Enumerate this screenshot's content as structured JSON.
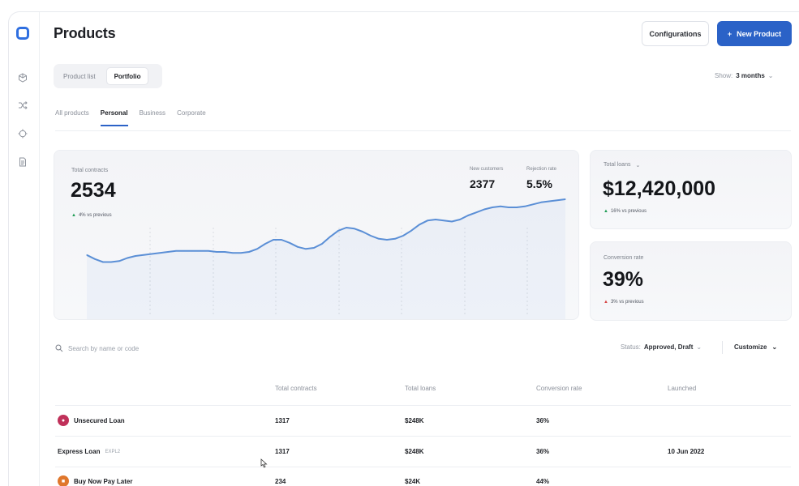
{
  "header": {
    "title": "Products",
    "configurations_label": "Configurations",
    "new_product_label": "New Product",
    "new_product_icon": "plus-icon"
  },
  "view_switch": {
    "options": [
      "Product list",
      "Portfolio"
    ],
    "selected": "Portfolio"
  },
  "range": {
    "prefix": "Show:",
    "value": "3 months"
  },
  "tabs": [
    {
      "label": "All products",
      "active": false
    },
    {
      "label": "Personal",
      "active": true
    },
    {
      "label": "Business",
      "active": false
    },
    {
      "label": "Corporate",
      "active": false
    }
  ],
  "contracts_card": {
    "label": "Total contracts",
    "value": "2534",
    "delta": "4% vs previous",
    "delta_direction": "up",
    "new_customers_label": "New customers",
    "new_customers_value": "2377",
    "rejection_label": "Rejection rate",
    "rejection_value": "5.5%"
  },
  "loans_card": {
    "label": "Total loans",
    "value": "$12,420,000",
    "delta": "16% vs previous",
    "delta_direction": "up"
  },
  "conversion_card": {
    "label": "Conversion rate",
    "value": "39%",
    "delta": "3% vs previous",
    "delta_direction": "down"
  },
  "chart_data": {
    "type": "line",
    "x": [
      0,
      1,
      2,
      3,
      4,
      5,
      6,
      7,
      8,
      9,
      10,
      11,
      12,
      13,
      14,
      15,
      16,
      17,
      18,
      19,
      20,
      21,
      22,
      23,
      24,
      25,
      26,
      27,
      28,
      29,
      30,
      31,
      32,
      33,
      34,
      35,
      36,
      37,
      38,
      39,
      40,
      41,
      42,
      43,
      44,
      45,
      46,
      47,
      48,
      49,
      50,
      51,
      52,
      53,
      54,
      55,
      56,
      57,
      58,
      59
    ],
    "y": [
      37,
      33,
      30,
      30,
      31,
      34,
      36,
      37,
      38,
      39,
      40,
      41,
      41,
      41,
      41,
      41,
      40,
      40,
      39,
      39,
      40,
      43,
      48,
      52,
      52,
      49,
      45,
      43,
      44,
      48,
      55,
      61,
      64,
      63,
      60,
      56,
      53,
      52,
      53,
      56,
      61,
      67,
      71,
      72,
      71,
      70,
      72,
      76,
      79,
      82,
      84,
      85,
      84,
      84,
      85,
      87,
      89,
      90,
      91,
      92
    ],
    "line_color": "#5b8fd6"
  },
  "table": {
    "search_placeholder": "Search by name or code",
    "status_prefix": "Status:",
    "status_value": "Approved, Draft",
    "customize_label": "Customize",
    "columns": [
      "Total contracts",
      "Total loans",
      "Conversion rate",
      "Launched"
    ],
    "rows": [
      {
        "name": "Unsecured Loan",
        "code": "",
        "icon_color": "#c0315a",
        "icon": "lock-icon",
        "contracts": "1317",
        "loans": "$248K",
        "conversion": "36%",
        "launched": ""
      },
      {
        "name": "Express Loan",
        "code": "EXPL2",
        "icon_color": "",
        "icon": "",
        "contracts": "1317",
        "loans": "$248K",
        "conversion": "36%",
        "launched": "10 Jun 2022"
      },
      {
        "name": "Buy Now Pay Later",
        "code": "",
        "icon_color": "#e0772c",
        "icon": "bag-icon",
        "contracts": "234",
        "loans": "$24K",
        "conversion": "44%",
        "launched": ""
      }
    ]
  }
}
